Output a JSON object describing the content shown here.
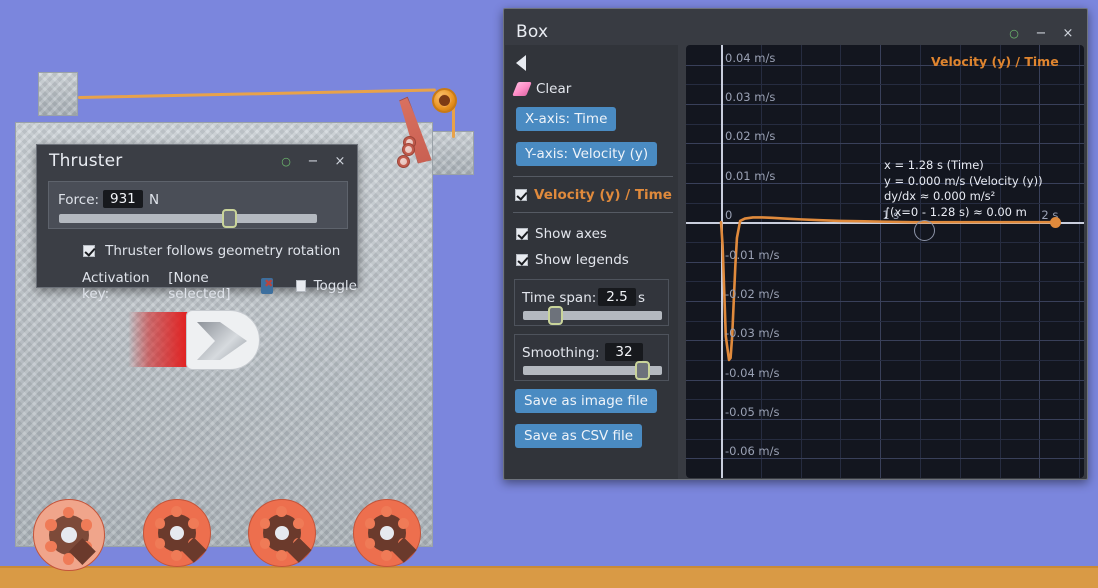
{
  "scene": {
    "name": "physics-sandbox-scene",
    "thruster_arrow_label": "thruster-direction-arrow"
  },
  "thruster_dialog": {
    "title": "Thruster",
    "buttons": {
      "help": "○",
      "minimize": "−",
      "close": "×"
    },
    "force": {
      "label": "Force:",
      "value": "931",
      "unit": "N",
      "slider_percent": 65
    },
    "follows_rotation": {
      "label": "Thruster follows geometry rotation",
      "checked": true
    },
    "activation": {
      "label": "Activation key:",
      "value": "[None selected]",
      "clear_key_icon": "clear-key-icon",
      "toggle_label": "Toggle",
      "toggle_checked": false
    }
  },
  "box_window": {
    "title": "Box",
    "buttons": {
      "help": "○",
      "minimize": "−",
      "close": "×"
    },
    "controls": {
      "back_icon": "back-arrow-icon",
      "clear": {
        "icon": "eraser-icon",
        "label": "Clear"
      },
      "x_axis_button": "X-axis: Time",
      "y_axis_button": "Y-axis: Velocity (y)",
      "series": {
        "label": "Velocity (y) / Time",
        "checked": true,
        "color": "#e08a3c"
      },
      "show_axes": {
        "label": "Show axes",
        "checked": true
      },
      "show_legends": {
        "label": "Show legends",
        "checked": true
      },
      "time_span": {
        "label": "Time span:",
        "value": "2.5",
        "unit": "s",
        "slider_percent": 20
      },
      "smoothing": {
        "label": "Smoothing:",
        "value": "32",
        "slider_percent": 86
      },
      "save_image_button": "Save as image file",
      "save_csv_button": "Save as CSV file"
    },
    "plot": {
      "legend_title": "Velocity (y) / Time",
      "annotation_lines": [
        "x = 1.28 s (Time)",
        "y = 0.000 m/s (Velocity (y))",
        "dy/dx ≈ 0.000 m/s²",
        "∫(x=0 - 1.28 s) ≈ 0.00 m"
      ]
    }
  },
  "chart_data": {
    "type": "line",
    "title": "Velocity (y) / Time",
    "xlabel": "Time",
    "ylabel": "Velocity (y)",
    "xlim": [
      -0.22,
      2.28
    ],
    "ylim": [
      -0.065,
      0.045
    ],
    "x_ticks": [
      {
        "value": 1,
        "label": "1 s"
      },
      {
        "value": 2,
        "label": "2 s"
      }
    ],
    "y_ticks": [
      {
        "value": 0.04,
        "label": "0.04 m/s"
      },
      {
        "value": 0.03,
        "label": "0.03 m/s"
      },
      {
        "value": 0.02,
        "label": "0.02 m/s"
      },
      {
        "value": 0.01,
        "label": "0.01 m/s"
      },
      {
        "value": 0,
        "label": "0"
      },
      {
        "value": -0.01,
        "label": "-0.01 m/s"
      },
      {
        "value": -0.02,
        "label": "-0.02 m/s"
      },
      {
        "value": -0.03,
        "label": "-0.03 m/s"
      },
      {
        "value": -0.04,
        "label": "-0.04 m/s"
      },
      {
        "value": -0.05,
        "label": "-0.05 m/s"
      },
      {
        "value": -0.06,
        "label": "-0.06 m/s"
      }
    ],
    "grid": true,
    "legend_position": "top-right",
    "series": [
      {
        "name": "Velocity (y) / Time",
        "color": "#e08a3c",
        "x": [
          0.0,
          0.01,
          0.02,
          0.03,
          0.05,
          0.06,
          0.07,
          0.08,
          0.09,
          0.1,
          0.12,
          0.15,
          0.2,
          0.26,
          0.32,
          0.4,
          0.5,
          0.62,
          0.75,
          0.9,
          1.05,
          1.2,
          1.4,
          1.6,
          1.8,
          2.0,
          2.1
        ],
        "y": [
          0.0,
          -0.006,
          -0.0175,
          -0.029,
          -0.035,
          -0.0345,
          -0.029,
          -0.02,
          -0.011,
          -0.004,
          0.0003,
          0.0009,
          0.0012,
          0.0012,
          0.0011,
          0.0009,
          0.0007,
          0.0005,
          0.0003,
          0.0002,
          0.0001,
          0.0,
          0.0,
          0.0,
          0.0,
          0.0,
          0.0
        ]
      }
    ],
    "cursor": {
      "x": 1.28,
      "y": 0.0
    },
    "end_marker": {
      "x": 2.1,
      "y": 0.0
    }
  }
}
